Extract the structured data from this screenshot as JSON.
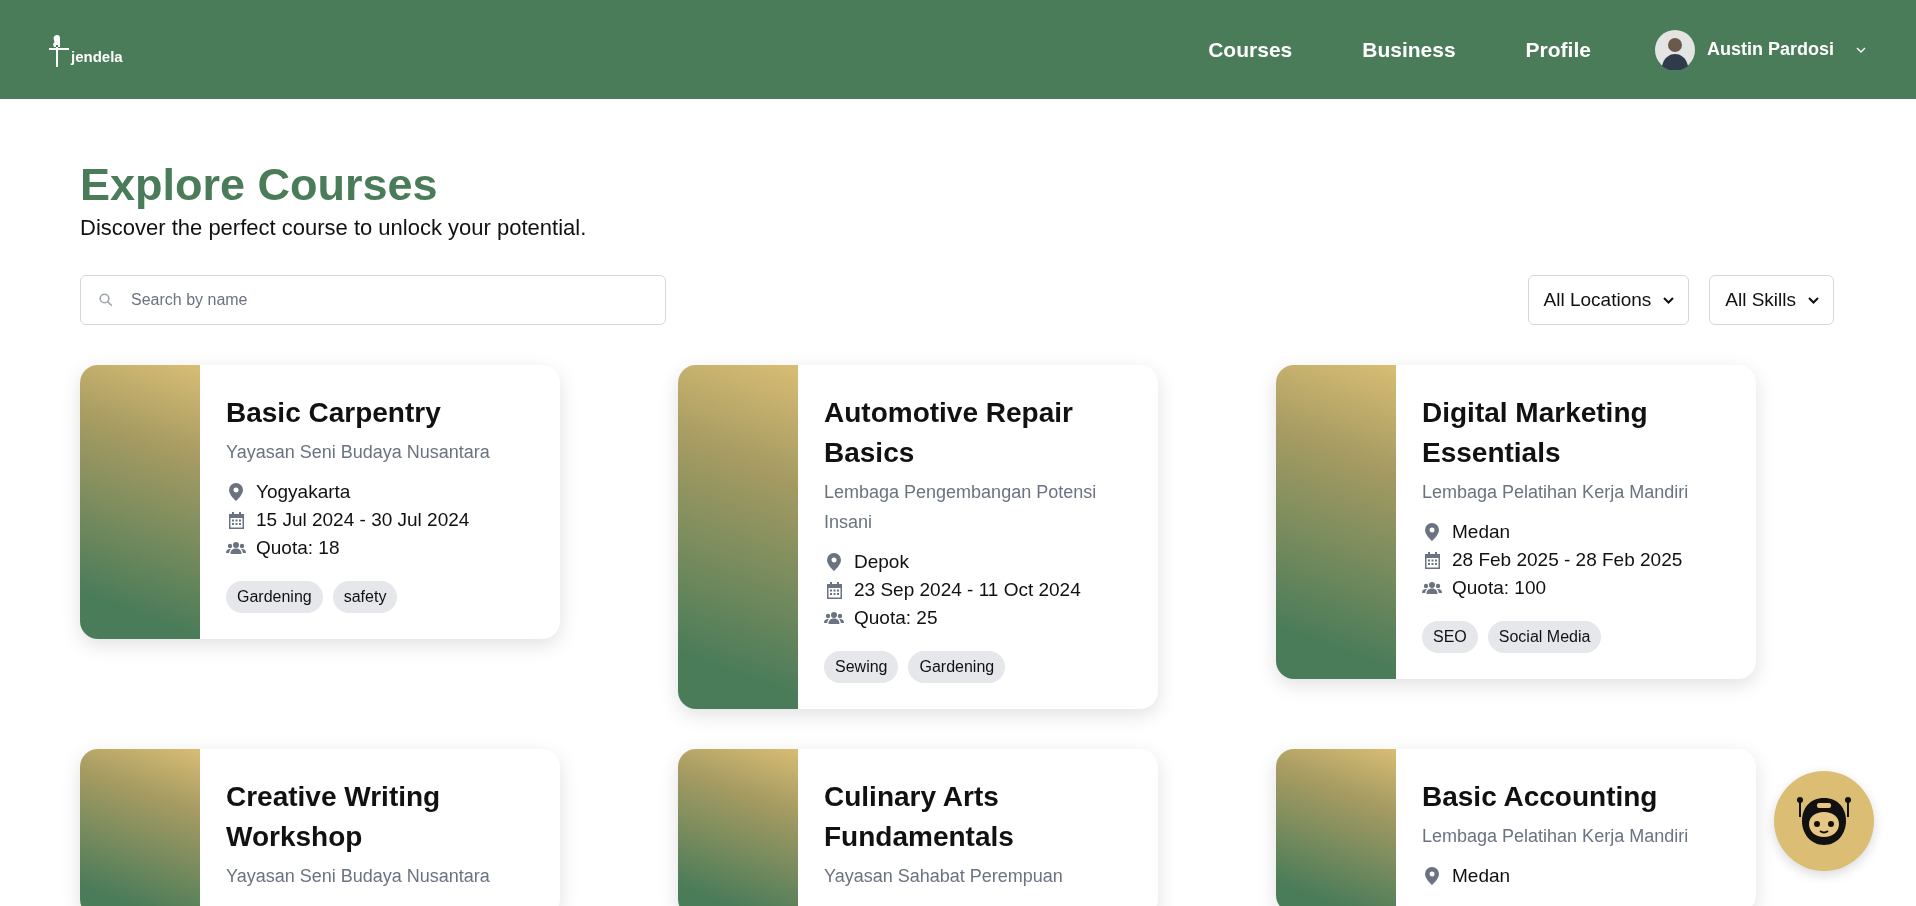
{
  "header": {
    "logo": "jendela",
    "nav": [
      {
        "label": "Courses"
      },
      {
        "label": "Business"
      },
      {
        "label": "Profile"
      }
    ],
    "user": {
      "name": "Austin Pardosi"
    }
  },
  "page": {
    "title": "Explore Courses",
    "subtitle": "Discover the perfect course to unlock your potential."
  },
  "search": {
    "placeholder": "Search by name"
  },
  "filters": [
    {
      "value": "All Locations"
    },
    {
      "value": "All Skills"
    }
  ],
  "courses": [
    {
      "title": "Basic Carpentry",
      "organizer": "Yayasan Seni Budaya Nusantara",
      "location": "Yogyakarta",
      "dates": "15 Jul 2024 - 30 Jul 2024",
      "quota": "Quota: 18",
      "tags": [
        "Gardening",
        "safety"
      ]
    },
    {
      "title": "Automotive Repair Basics",
      "organizer": "Lembaga Pengembangan Potensi Insani",
      "location": "Depok",
      "dates": "23 Sep 2024 - 11 Oct 2024",
      "quota": "Quota: 25",
      "tags": [
        "Sewing",
        "Gardening"
      ]
    },
    {
      "title": "Digital Marketing Essentials",
      "organizer": "Lembaga Pelatihan Kerja Mandiri",
      "location": "Medan",
      "dates": "28 Feb 2025 - 28 Feb 2025",
      "quota": "Quota: 100",
      "tags": [
        "SEO",
        "Social Media"
      ]
    },
    {
      "title": "Creative Writing Workshop",
      "organizer": "Yayasan Seni Budaya Nusantara"
    },
    {
      "title": "Culinary Arts Fundamentals",
      "organizer": "Yayasan Sahabat Perempuan"
    },
    {
      "title": "Basic Accounting",
      "organizer": "Lembaga Pelatihan Kerja Mandiri",
      "location": "Medan"
    }
  ]
}
